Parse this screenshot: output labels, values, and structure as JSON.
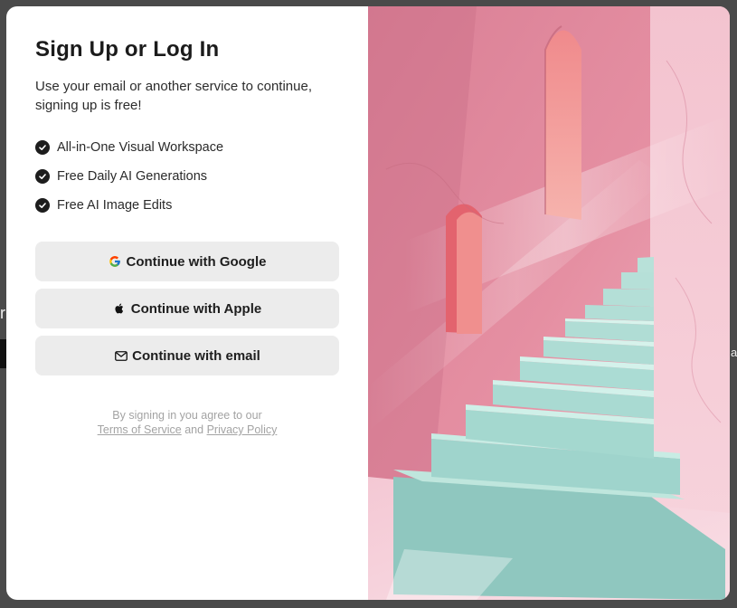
{
  "modal": {
    "title": "Sign Up or Log In",
    "subtitle": "Use your email or another service to continue, signing up is free!",
    "features": [
      "All-in-One Visual Workspace",
      "Free Daily AI Generations",
      "Free AI Image Edits"
    ],
    "buttons": {
      "google": "Continue with Google",
      "apple": "Continue with Apple",
      "email": "Continue with email"
    },
    "legal": {
      "prefix": "By signing in you agree to our",
      "terms": "Terms of Service",
      "and": "and",
      "privacy": "Privacy Policy"
    }
  },
  "backdrop": {
    "left_fragment": "r",
    "right_fragment": "a"
  },
  "colors": {
    "button_bg": "#ececec",
    "text": "#1b1b1b",
    "legal": "#a3a3a3",
    "wall_pink": "#e8a0b2",
    "stairs_mint": "#a8ddd4"
  }
}
